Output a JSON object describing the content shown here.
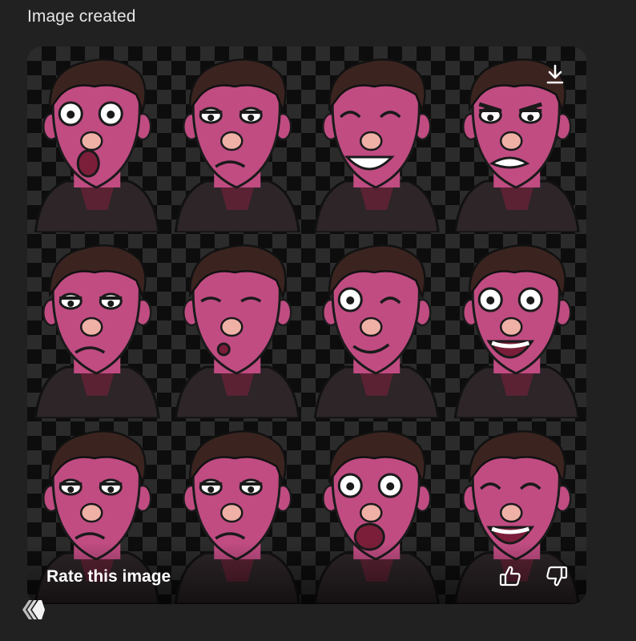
{
  "status": {
    "label": "Image created"
  },
  "image": {
    "panels": [
      {
        "expression": "surprised"
      },
      {
        "expression": "sad"
      },
      {
        "expression": "grinning"
      },
      {
        "expression": "angry"
      },
      {
        "expression": "unimpressed"
      },
      {
        "expression": "kiss"
      },
      {
        "expression": "winking"
      },
      {
        "expression": "excited"
      },
      {
        "expression": "bored"
      },
      {
        "expression": "sleepy"
      },
      {
        "expression": "shocked"
      },
      {
        "expression": "laughing"
      }
    ],
    "rate_label": "Rate this image",
    "icons": {
      "download": "download-icon",
      "like": "thumbs-up-icon",
      "dislike": "thumbs-down-icon"
    }
  },
  "colors": {
    "background": "#212121",
    "skin": "#c04c82",
    "hair": "#3b2420",
    "hoodie": "#2d2528",
    "nose": "#efb0a6"
  }
}
